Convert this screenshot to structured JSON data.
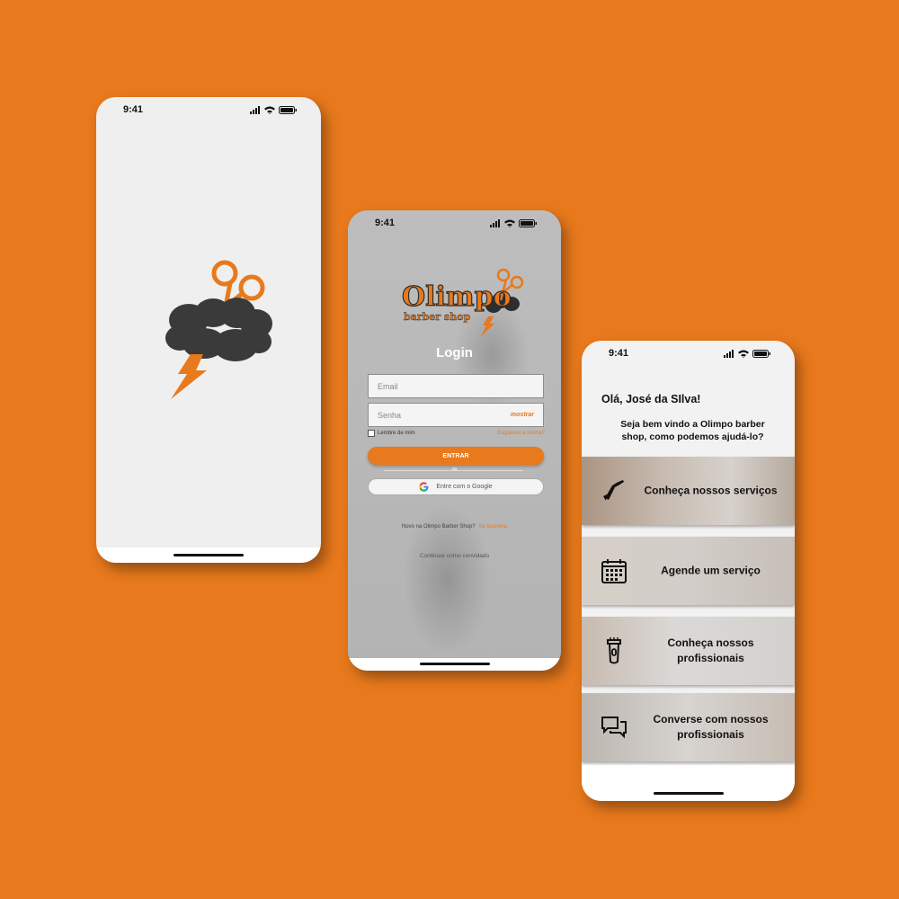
{
  "colors": {
    "brand_orange": "#E8791C",
    "background": "#E8791C",
    "dark_cloud": "#3A3A3A"
  },
  "splash": {
    "time": "9:41",
    "logo": "olimpo-cloud-scissors-logo"
  },
  "login": {
    "time": "9:41",
    "logo_title": "Olimpo",
    "logo_subtitle": "barber shop",
    "title": "Login",
    "email_placeholder": "Email",
    "password_placeholder": "Senha",
    "show_password": "mostrar",
    "remember_me": "Lembre de mim",
    "forgot_password": "Esqueceu a senha?",
    "enter_button": "ENTRAR",
    "or_text": "ou",
    "google_button": "Entre com o Google",
    "signup_text": "Novo na Olimpo Barber Shop?",
    "signup_link": "Se inscreva",
    "guest_link": "Continuar como convidado"
  },
  "home": {
    "time": "9:41",
    "greeting": "Olá, José da SIlva!",
    "welcome": "Seja bem vindo a Olimpo barber shop, como podemos ajudá-lo?",
    "cards": [
      {
        "icon": "razor-icon",
        "label": "Conheça nossos serviços"
      },
      {
        "icon": "calendar-icon",
        "label": "Agende um serviço"
      },
      {
        "icon": "clipper-icon",
        "label": "Conheça nossos profissionais"
      },
      {
        "icon": "chat-icon",
        "label": "Converse com nossos profissionais"
      }
    ]
  }
}
